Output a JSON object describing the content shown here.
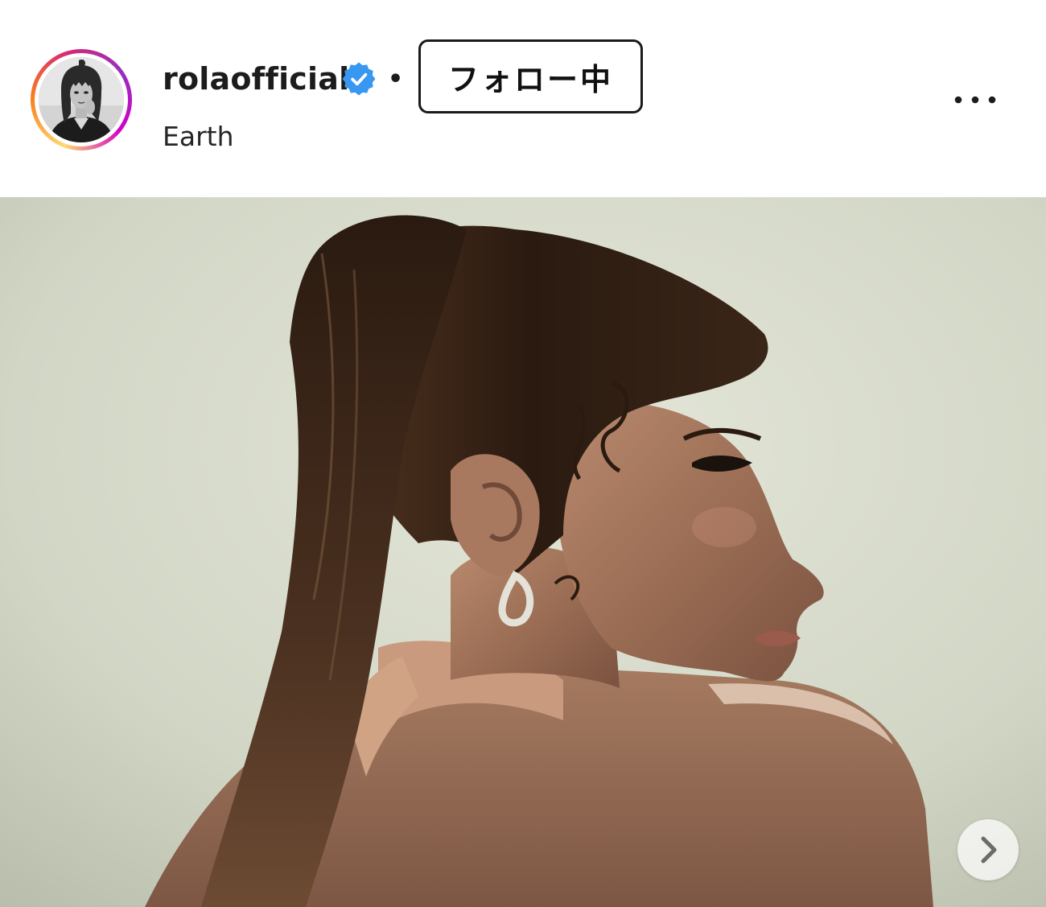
{
  "post": {
    "account": {
      "username": "rolaofficial",
      "verified": true,
      "avatar_icon": "profile-photo",
      "story_ring_colors": [
        "#feda75",
        "#fa7e1e",
        "#d62976",
        "#962fbf",
        "#d300c5"
      ]
    },
    "separator": "•",
    "follow_button": {
      "label": "フォロー中"
    },
    "location": "Earth",
    "more_options_icon": "more-horizontal-icon",
    "media": {
      "type": "photo carousel",
      "next_icon": "chevron-right-icon"
    }
  },
  "colors": {
    "verified_badge": "#3897f0",
    "text": "#1c1c1c",
    "background": "#ffffff"
  }
}
